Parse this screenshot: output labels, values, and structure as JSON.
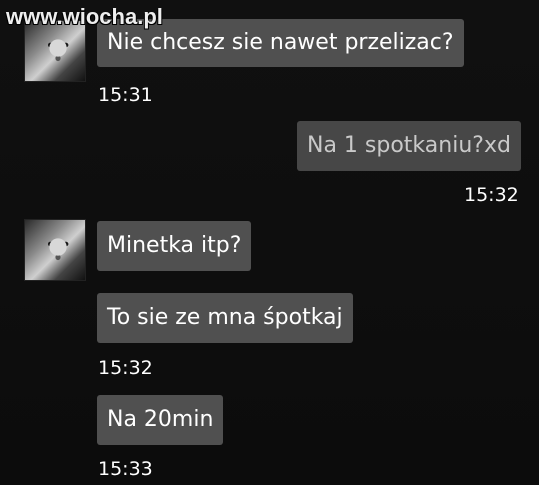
{
  "watermark": "www.wiocha.pl",
  "messages": [
    {
      "text": "Nie chcesz sie nawet przelizac?",
      "time": "15:31"
    },
    {
      "text": "Na 1 spotkaniu?xd",
      "time": "15:32"
    },
    {
      "text": "Minetka itp?"
    },
    {
      "text": "To sie ze mna śpotkaj",
      "time": "15:32"
    },
    {
      "text": "Na 20min",
      "time": "15:33"
    }
  ]
}
